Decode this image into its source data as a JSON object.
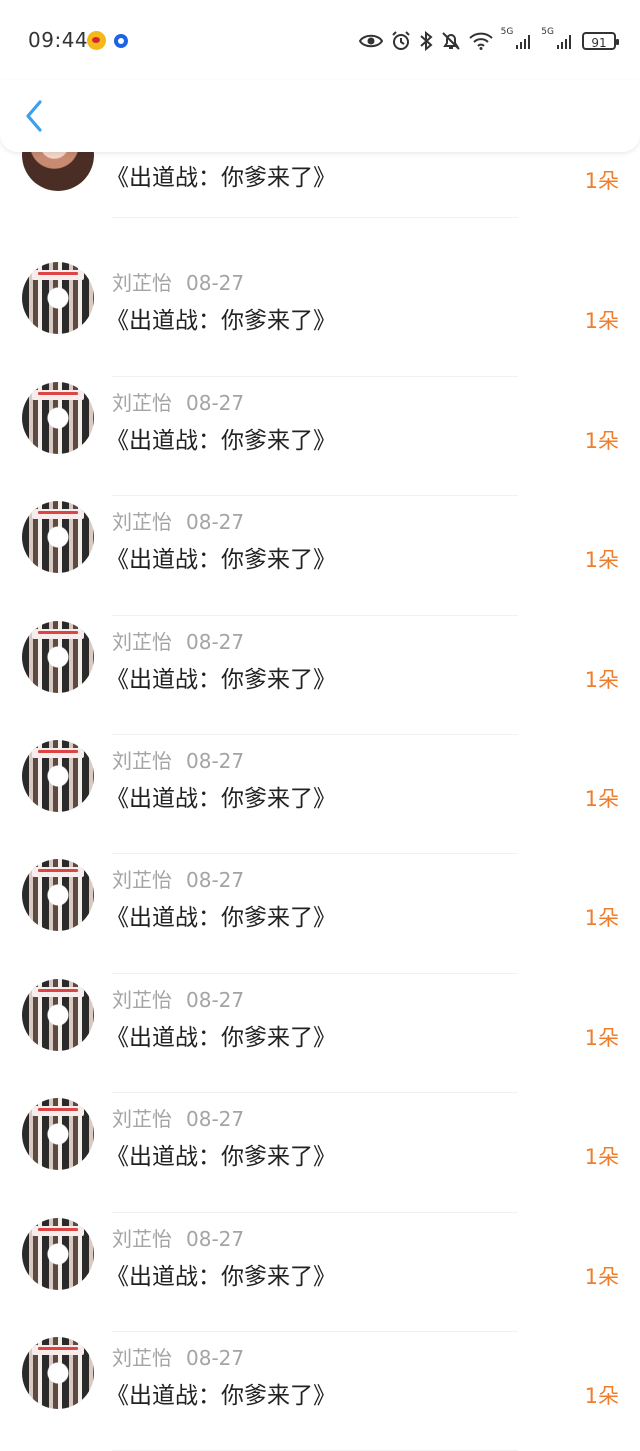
{
  "status_bar": {
    "time": "09:44",
    "network_left": "5G",
    "network_right": "5G",
    "battery": "91"
  },
  "header": {
    "back_icon": "chevron-left-icon",
    "accent": "#3aa1f0"
  },
  "gift_list": [
    {
      "name": "",
      "date": "",
      "title": "《出道战：你爹来了》",
      "count": "1朵"
    },
    {
      "name": "刘芷怡",
      "date": "08-27",
      "title": "《出道战：你爹来了》",
      "count": "1朵"
    },
    {
      "name": "刘芷怡",
      "date": "08-27",
      "title": "《出道战：你爹来了》",
      "count": "1朵"
    },
    {
      "name": "刘芷怡",
      "date": "08-27",
      "title": "《出道战：你爹来了》",
      "count": "1朵"
    },
    {
      "name": "刘芷怡",
      "date": "08-27",
      "title": "《出道战：你爹来了》",
      "count": "1朵"
    },
    {
      "name": "刘芷怡",
      "date": "08-27",
      "title": "《出道战：你爹来了》",
      "count": "1朵"
    },
    {
      "name": "刘芷怡",
      "date": "08-27",
      "title": "《出道战：你爹来了》",
      "count": "1朵"
    },
    {
      "name": "刘芷怡",
      "date": "08-27",
      "title": "《出道战：你爹来了》",
      "count": "1朵"
    },
    {
      "name": "刘芷怡",
      "date": "08-27",
      "title": "《出道战：你爹来了》",
      "count": "1朵"
    },
    {
      "name": "刘芷怡",
      "date": "08-27",
      "title": "《出道战：你爹来了》",
      "count": "1朵"
    },
    {
      "name": "刘芷怡",
      "date": "08-27",
      "title": "《出道战：你爹来了》",
      "count": "1朵"
    }
  ],
  "colors": {
    "count_text": "#ef7d2b",
    "meta_text": "#a4a4a4",
    "title_text": "#222222"
  }
}
